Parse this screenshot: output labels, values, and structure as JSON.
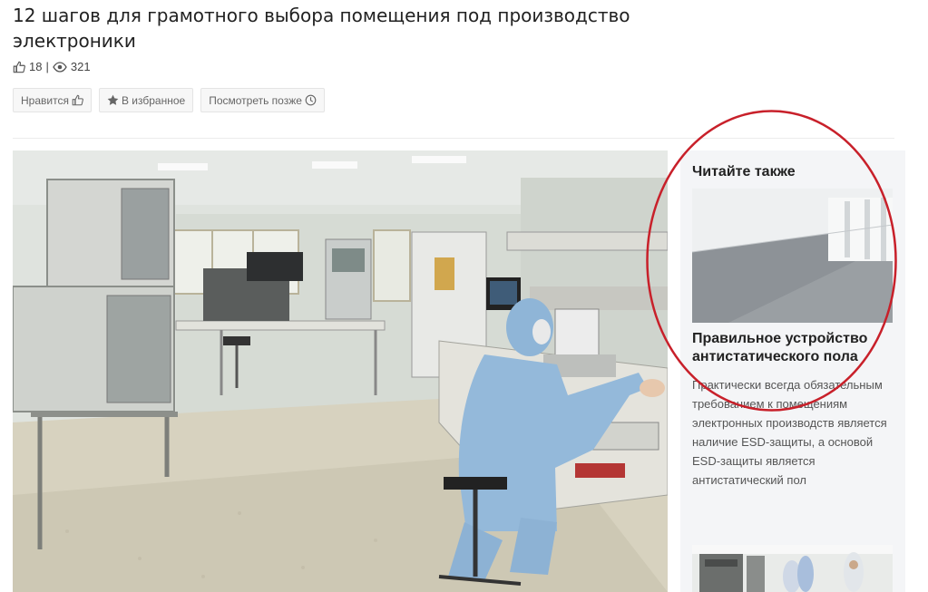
{
  "article": {
    "title": "12 шагов для грамотного выбора помещения под производство электроники",
    "likes": "18",
    "separator": "|",
    "views": "321"
  },
  "actions": {
    "like_label": "Нравится",
    "favorite_label": "В избранное",
    "later_label": "Посмотреть позже"
  },
  "icons": {
    "like": "thumbs-up-icon",
    "views": "eye-icon",
    "favorite": "star-icon",
    "later": "clock-icon"
  },
  "sidebar": {
    "heading": "Читайте также",
    "article_title": "Правильное устройство антистатического пола",
    "article_excerpt": "Практически всегда обязательным требованием к помещениям электронных производств является наличие ESD-защиты, а основой ESD-защиты является антистатический пол"
  },
  "colors": {
    "annotation_circle": "#c8202a",
    "sidebar_bg": "#f4f5f7",
    "button_border": "#e4e4e4"
  }
}
